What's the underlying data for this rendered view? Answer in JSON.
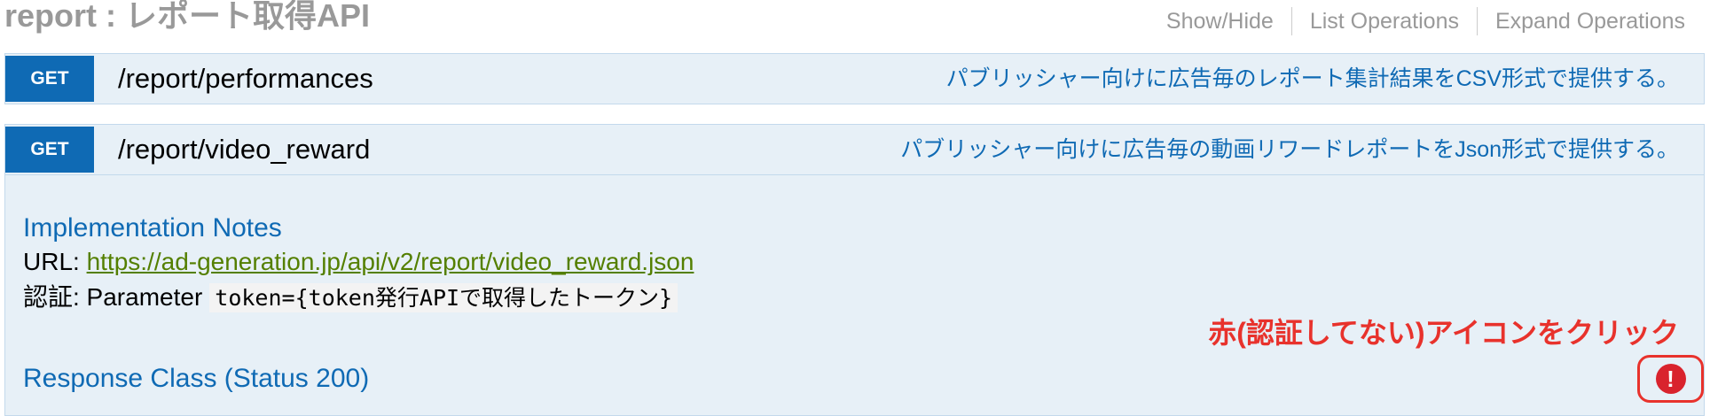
{
  "resource": {
    "title": "report : レポート取得API",
    "links": [
      "Show/Hide",
      "List Operations",
      "Expand Operations"
    ]
  },
  "operations": [
    {
      "method": "GET",
      "path": "/report/performances",
      "summary": "パブリッシャー向けに広告毎のレポート集計結果をCSV形式で提供する。"
    },
    {
      "method": "GET",
      "path": "/report/video_reward",
      "summary": "パブリッシャー向けに広告毎の動画リワードレポートをJson形式で提供する。",
      "implementation_notes": {
        "heading": "Implementation Notes",
        "url_label": "URL: ",
        "url": "https://ad-generation.jp/api/v2/report/video_reward.json",
        "auth_label": "認証: Parameter",
        "auth_code": "token={token発行APIで取得したトークン}"
      },
      "annotation": "赤(認証してない)アイコンをクリック",
      "response_class": "Response Class (Status 200)",
      "auth_icon": "exclamation-icon",
      "auth_icon_glyph": "!"
    }
  ],
  "colors": {
    "method_get": "#0f6ab4",
    "summary_text": "#0f6ab4",
    "op_background": "#e7f0f7",
    "link_green": "#547f00",
    "annotation_red": "#e8322c",
    "muted_gray": "#999999"
  }
}
